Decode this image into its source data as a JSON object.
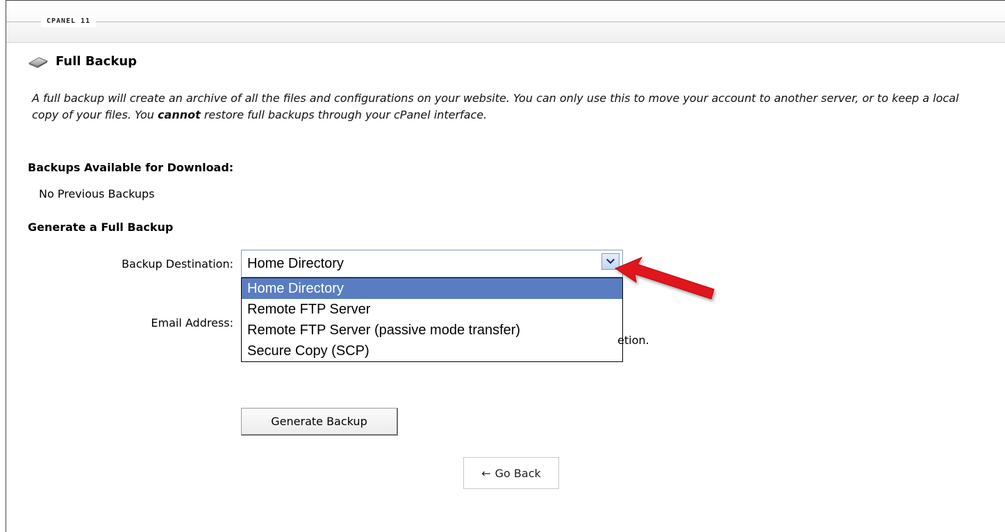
{
  "header": {
    "brand": "CPANEL 11"
  },
  "page": {
    "title": "Full Backup",
    "description_part1": "A full backup will create an archive of all the files and configurations on your website. You can only use this to move your account to another server, or to keep a local copy of your files. You ",
    "description_bold": "cannot",
    "description_part2": " restore full backups through your cPanel interface."
  },
  "available": {
    "heading": "Backups Available for Download:",
    "empty_text": "No Previous Backups"
  },
  "generate": {
    "heading": "Generate a Full Backup",
    "destination_label": "Backup Destination:",
    "destination_selected": "Home Directory",
    "destination_options": [
      "Home Directory",
      "Remote FTP Server",
      "Remote FTP Server (passive mode transfer)",
      "Secure Copy (SCP)"
    ],
    "email_label": "Email Address:",
    "email_note_visible": "etion.",
    "button_label": "Generate Backup"
  },
  "footer": {
    "go_back_arrow": "←",
    "go_back_label": "Go Back"
  },
  "icons": {
    "title_icon": "disk-icon",
    "dropdown_icon": "chevron-down-icon",
    "annotation": "red-arrow-icon"
  },
  "colors": {
    "selected_option": "#5a7dc2",
    "annotation_arrow": "#e0141c"
  }
}
